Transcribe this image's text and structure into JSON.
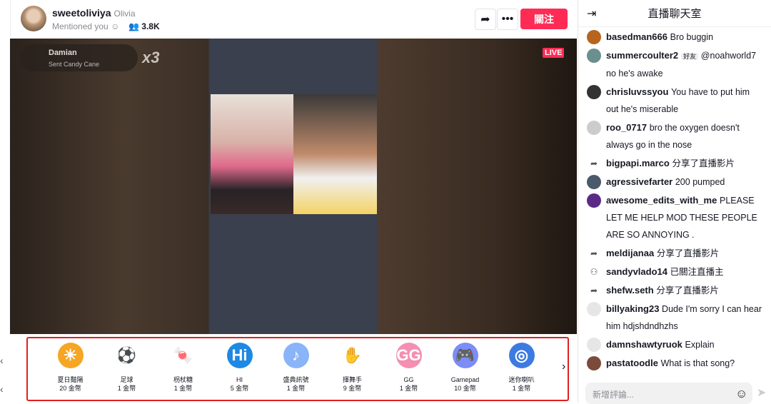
{
  "header": {
    "username": "sweetoliviya",
    "nickname": "Olivia",
    "subtitle": "Mentioned you",
    "viewers": "3.8K",
    "follow_label": "關注"
  },
  "video": {
    "gift_notice": {
      "name": "Damian",
      "text": "Sent Candy Cane",
      "combo": "x3"
    },
    "live_badge": "LIVE"
  },
  "gifts": [
    {
      "name": "夏日豔陽",
      "price": "20 金幣",
      "icon": "☀",
      "color": "#f6a623"
    },
    {
      "name": "足球",
      "price": "1 金幣",
      "icon": "⚽",
      "color": "#ffffff"
    },
    {
      "name": "枴杖糖",
      "price": "1 金幣",
      "icon": "🍬",
      "color": "#ffffff"
    },
    {
      "name": "HI",
      "price": "5 金幣",
      "icon": "Hi",
      "color": "#1e88e5"
    },
    {
      "name": "盛典訊號",
      "price": "1 金幣",
      "icon": "♪",
      "color": "#8ab4f8"
    },
    {
      "name": "揮舞手",
      "price": "9 金幣",
      "icon": "✋",
      "color": "#ffffff"
    },
    {
      "name": "GG",
      "price": "1 金幣",
      "icon": "GG",
      "color": "#f48fb1"
    },
    {
      "name": "Gamepad",
      "price": "10 金幣",
      "icon": "🎮",
      "color": "#7c8cf8"
    },
    {
      "name": "迷你喇叭",
      "price": "1 金幣",
      "icon": "◎",
      "color": "#3d7be0"
    }
  ],
  "chat": {
    "title": "直播聊天室",
    "input_placeholder": "新增評論...",
    "messages": [
      {
        "user": "basedman666",
        "text": "Bro buggin",
        "type": "comment"
      },
      {
        "user": "summercoulter2",
        "badge": "好友",
        "text": "@noahworld7 no he's awake",
        "type": "comment"
      },
      {
        "user": "chrisluvssyou",
        "text": "You have to put him out he's miserable",
        "type": "comment"
      },
      {
        "user": "roo_0717",
        "text": "bro the oxygen doesn't always go in the nose",
        "type": "comment"
      },
      {
        "user": "bigpapi.marco",
        "text": "分享了直播影片",
        "type": "share"
      },
      {
        "user": "agressivefarter",
        "text": "200 pumped",
        "type": "comment"
      },
      {
        "user": "awesome_edits_with_me",
        "text": "PLEASE LET ME HELP MOD THESE PEOPLE ARE SO ANNOYING .",
        "type": "comment"
      },
      {
        "user": "meldijanaa",
        "text": "分享了直播影片",
        "type": "share"
      },
      {
        "user": "sandyvlado14",
        "text": "已關注直播主",
        "type": "follow"
      },
      {
        "user": "shefw.seth",
        "text": "分享了直播影片",
        "type": "share"
      },
      {
        "user": "billyaking23",
        "text": "Dude I'm sorry I can hear him hdjshdndhzhs",
        "type": "comment"
      },
      {
        "user": "damnshawtyruok",
        "text": "Explain",
        "type": "comment"
      },
      {
        "user": "pastatoodle",
        "text": "What is that song?",
        "type": "comment"
      }
    ]
  }
}
